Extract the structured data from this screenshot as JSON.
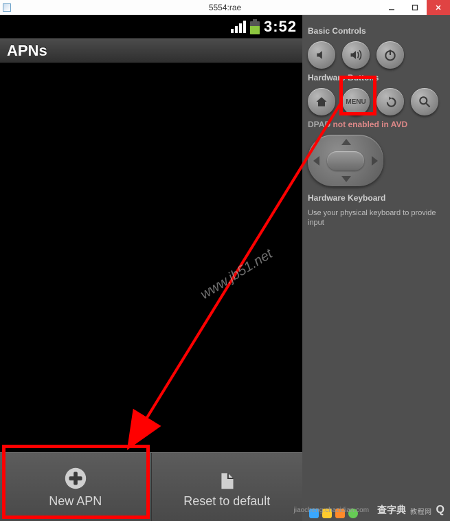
{
  "window": {
    "title": "5554:rae",
    "buttons": {
      "min": "–",
      "max": "▢",
      "close": "✕"
    }
  },
  "status": {
    "time": "3:52"
  },
  "screen": {
    "title": "APNs"
  },
  "menu": {
    "new_apn": "New APN",
    "reset": "Reset to default"
  },
  "panel": {
    "basic_title": "Basic Controls",
    "hw_buttons_title": "Hardware Buttons",
    "menu_text": "MENU",
    "dpad_label": "DPAD",
    "dpad_status": "not enabled in AVD",
    "hw_kb_title": "Hardware Keyboard",
    "hw_kb_note": "Use your physical keyboard to provide input"
  },
  "watermarks": {
    "wm1": "www.jb51.net",
    "wm2_cn": "查字典",
    "wm2_sub": "教程网",
    "wm2_url": "jiaocheng.chazidian.com",
    "wm2_q": "Q"
  }
}
